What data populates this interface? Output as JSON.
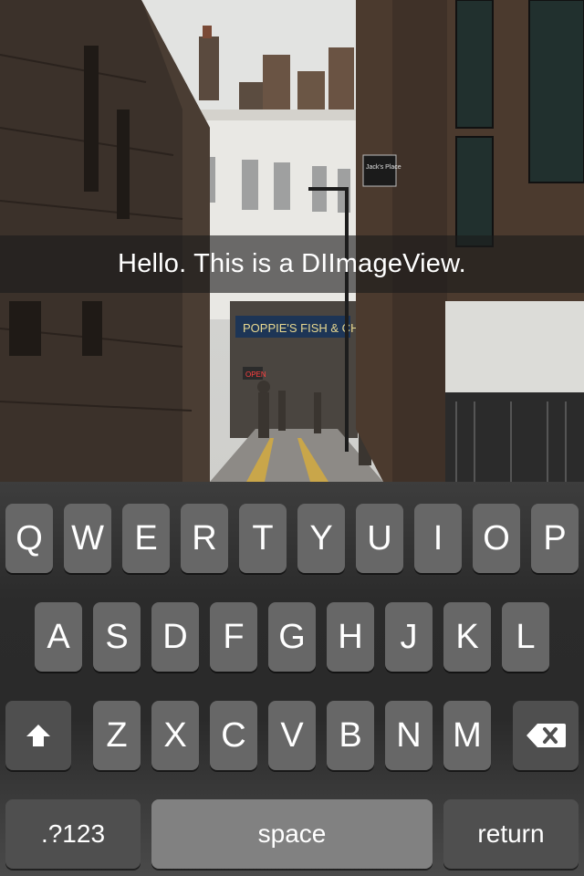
{
  "caption": {
    "text": "Hello. This is a DIImageView."
  },
  "photo": {
    "signs": {
      "pub": "Jack's Place",
      "shop": "POPPIE'S FISH & CHIPS",
      "open": "OPEN"
    }
  },
  "keyboard": {
    "row1": [
      "Q",
      "W",
      "E",
      "R",
      "T",
      "Y",
      "U",
      "I",
      "O",
      "P"
    ],
    "row2": [
      "A",
      "S",
      "D",
      "F",
      "G",
      "H",
      "J",
      "K",
      "L"
    ],
    "row3": [
      "Z",
      "X",
      "C",
      "V",
      "B",
      "N",
      "M"
    ],
    "shift_icon": "shift-icon",
    "delete_icon": "backspace-icon",
    "numbers_label": ".?123",
    "space_label": "space",
    "return_label": "return"
  }
}
